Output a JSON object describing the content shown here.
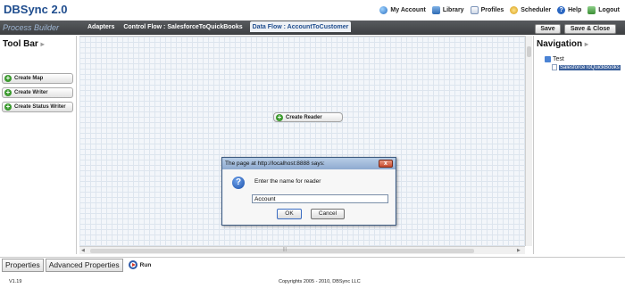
{
  "app": {
    "title": "DBSync 2.0",
    "subtitle": "Process Builder"
  },
  "topnav": [
    {
      "label": "My Account",
      "icon": "globe-icon"
    },
    {
      "label": "Library",
      "icon": "library-icon"
    },
    {
      "label": "Profiles",
      "icon": "profiles-icon"
    },
    {
      "label": "Scheduler",
      "icon": "scheduler-icon"
    },
    {
      "label": "Help",
      "icon": "help-icon"
    },
    {
      "label": "Logout",
      "icon": "logout-icon"
    }
  ],
  "tabs": [
    {
      "label": "Adapters"
    },
    {
      "label": "Control Flow : SalesforceToQuickBooks"
    },
    {
      "label": "Data Flow : AccountToCustomer",
      "active": true
    }
  ],
  "actions": {
    "save": "Save",
    "save_close": "Save & Close"
  },
  "toolbar": {
    "title": "Tool Bar",
    "items": [
      "Create Map",
      "Create Writer",
      "Create Status Writer"
    ]
  },
  "canvas": {
    "node_label": "Create Reader"
  },
  "navigation": {
    "title": "Navigation",
    "root": "Test",
    "child": "SalesforceToQuickBooks"
  },
  "dialog": {
    "title": "The page at http://localhost:8888 says:",
    "message": "Enter the name for reader",
    "input_value": "Account",
    "ok": "OK",
    "cancel": "Cancel"
  },
  "bottom": {
    "tabs": [
      "Properties",
      "Advanced Properties"
    ],
    "run": "Run"
  },
  "footer": {
    "version": "V1.19",
    "copyright": "Copyrights 2005 - 2010, DBSync LLC"
  },
  "colors": {
    "brand": "#1f4d8e",
    "toolbar_dark": "#45484b",
    "add_green": "#3c9a2f"
  }
}
